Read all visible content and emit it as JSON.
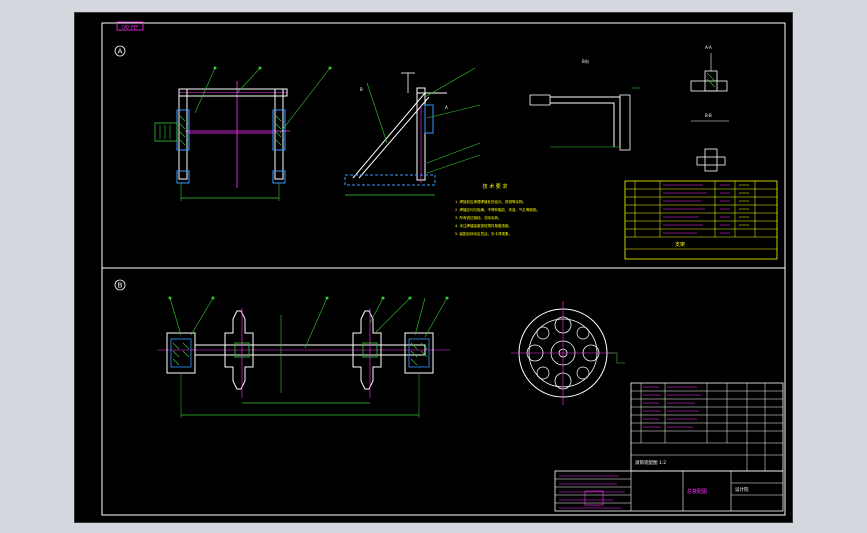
{
  "drawing": {
    "stamp_label": "CAD-REF",
    "view_a_label": "A",
    "view_b_label": "B",
    "notes_title": "技 术 要 求",
    "notes": [
      "1. 焊接前应清理焊缝处的油污、铁锈等杂物。",
      "2. 焊缝应均匀饱满，不得有裂纹、夹渣、气孔等缺陷。",
      "3. 所有锐边倒钝，去除毛刺。",
      "4. 未注焊缝高度按较薄件厚度选取。",
      "5. 装配后转动应灵活，无卡滞现象。"
    ],
    "title_block_a": "支架",
    "title_block_b": "滚筒装配图 1:2",
    "company": "设计院",
    "drawing_name": "总装配图"
  },
  "colors": {
    "background": "#000000",
    "outline": "#ffffff",
    "dimension": "#00ff66",
    "center_line": "#ff33ff",
    "hidden": "#3399ff",
    "title_block": "#ffff00",
    "hatch": "#33cc33"
  }
}
